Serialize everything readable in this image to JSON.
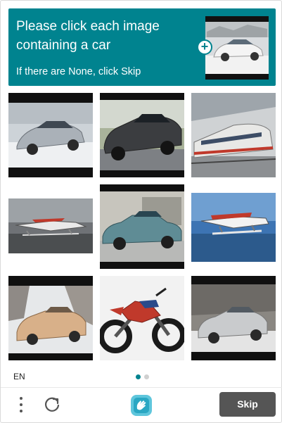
{
  "prompt": {
    "title": "Please click each image containing a car",
    "subtitle": "If there are None, click Skip",
    "background_color": "#00838f",
    "example_icon": "car-example-thumbnail",
    "badge_icon": "plus-icon"
  },
  "grid": {
    "tiles": [
      {
        "subject": "silver sedan on snow",
        "row": 1,
        "col": 1
      },
      {
        "subject": "black sedan on road",
        "row": 1,
        "col": 2
      },
      {
        "subject": "train at station",
        "row": 1,
        "col": 3
      },
      {
        "subject": "seaplane on water",
        "row": 2,
        "col": 1
      },
      {
        "subject": "blue vintage car",
        "row": 2,
        "col": 2
      },
      {
        "subject": "seaplane on water",
        "row": 2,
        "col": 3
      },
      {
        "subject": "tan car in snow",
        "row": 3,
        "col": 1
      },
      {
        "subject": "red motorcycle",
        "row": 3,
        "col": 2
      },
      {
        "subject": "silver car in snow",
        "row": 3,
        "col": 3
      }
    ]
  },
  "footer": {
    "language": "EN",
    "pagination": {
      "total": 2,
      "active": 1,
      "active_color": "#00838f",
      "inactive_color": "#d0d0d0"
    },
    "menu_icon": "more-vertical-icon",
    "refresh_icon": "refresh-icon",
    "logo_icon": "hcaptcha-hand-logo",
    "skip_label": "Skip",
    "skip_color": "#555555"
  }
}
